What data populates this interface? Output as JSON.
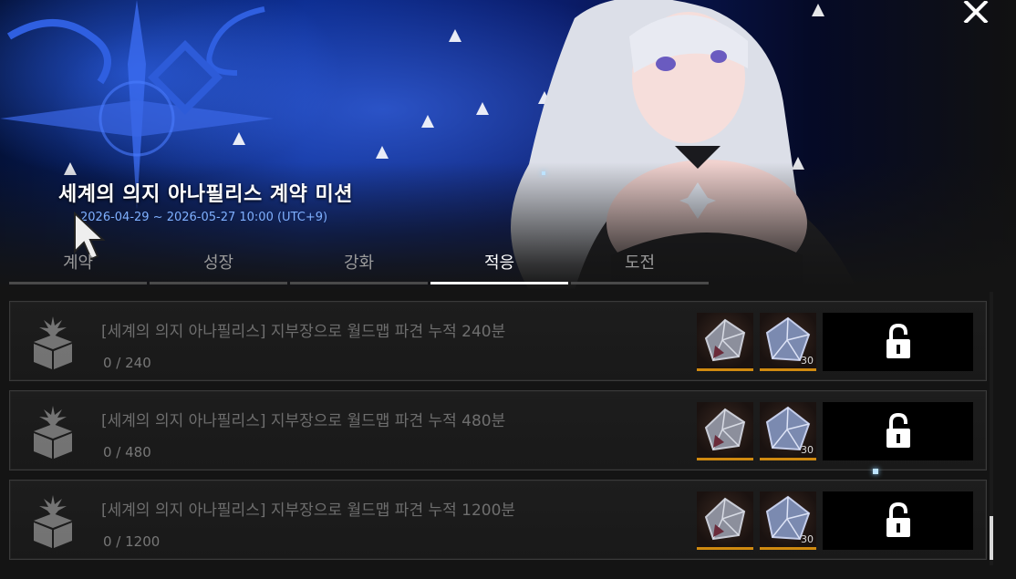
{
  "event": {
    "title": "세계의 의지 아나필리스 계약 미션",
    "period": "2026-04-29 ~ 2026-05-27 10:00 (UTC+9)"
  },
  "tabs": [
    {
      "label": "계약",
      "active": false
    },
    {
      "label": "성장",
      "active": false
    },
    {
      "label": "강화",
      "active": false
    },
    {
      "label": "적응",
      "active": true
    },
    {
      "label": "도전",
      "active": false
    }
  ],
  "missions": [
    {
      "title": "[세계의 의지 아나필리스] 지부장으로 월드맵 파견 누적 240분",
      "progress": "0 / 240",
      "reward_qty": "30"
    },
    {
      "title": "[세계의 의지 아나필리스] 지부장으로 월드맵 파견 누적 480분",
      "progress": "0 / 480",
      "reward_qty": "30"
    },
    {
      "title": "[세계의 의지 아나필리스] 지부장으로 월드맵 파견 누적 1200분",
      "progress": "0 / 1200",
      "reward_qty": "30"
    }
  ],
  "icons": {
    "close": "close-icon",
    "mission": "gift-box-icon",
    "reward_1": "crystal-icon",
    "reward_2": "crystal-shard-icon",
    "claim": "lock-icon"
  },
  "colors": {
    "active_tab": "#f2f2f2",
    "reward_border": "#d08a10",
    "period_text": "#7fb0ff"
  }
}
